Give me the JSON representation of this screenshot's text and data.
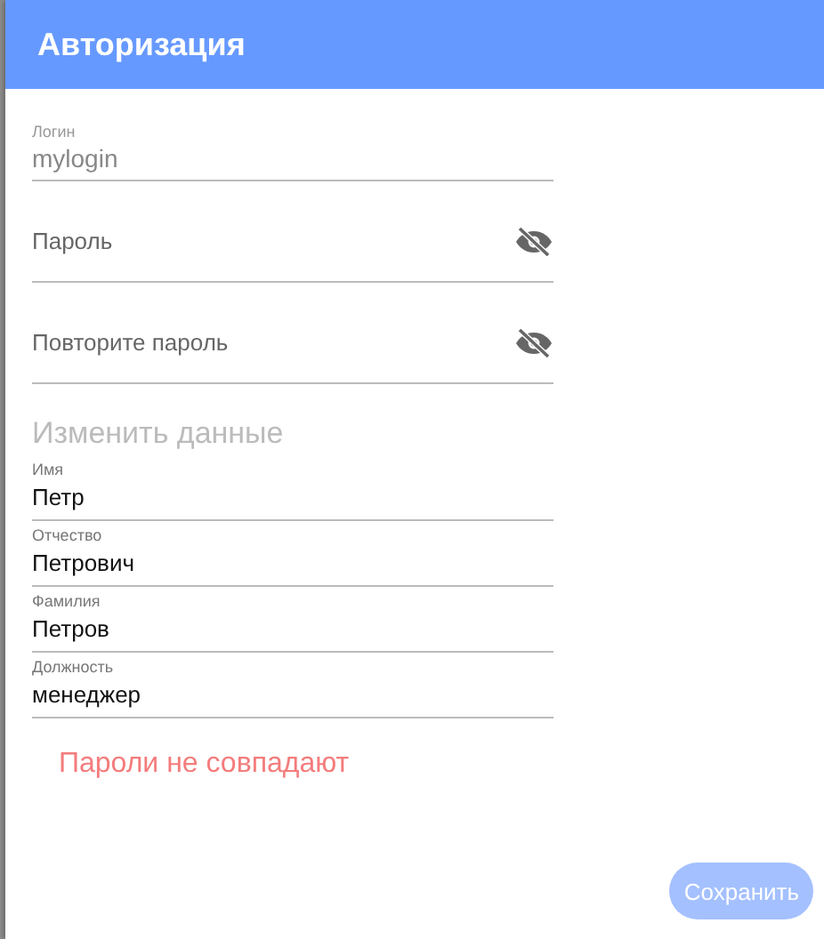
{
  "dialog": {
    "title": "Авторизация"
  },
  "auth_fields": [
    {
      "kind": "text",
      "label": "Логин",
      "value": "mylogin",
      "disabled": true
    },
    {
      "kind": "password",
      "placeholder": "Пароль",
      "show_password": false
    },
    {
      "kind": "password",
      "placeholder": "Повторите пароль",
      "show_password": false
    }
  ],
  "section_heading": "Изменить данные",
  "profile_fields": [
    {
      "label": "Имя",
      "value": "Петр"
    },
    {
      "label": "Отчество",
      "value": "Петрович"
    },
    {
      "label": "Фамилия",
      "value": "Петров"
    },
    {
      "label": "Должность",
      "value": "менеджер"
    }
  ],
  "error": "Пароли не совпадают",
  "save_button": {
    "label": "Сохранить",
    "disabled": true
  }
}
